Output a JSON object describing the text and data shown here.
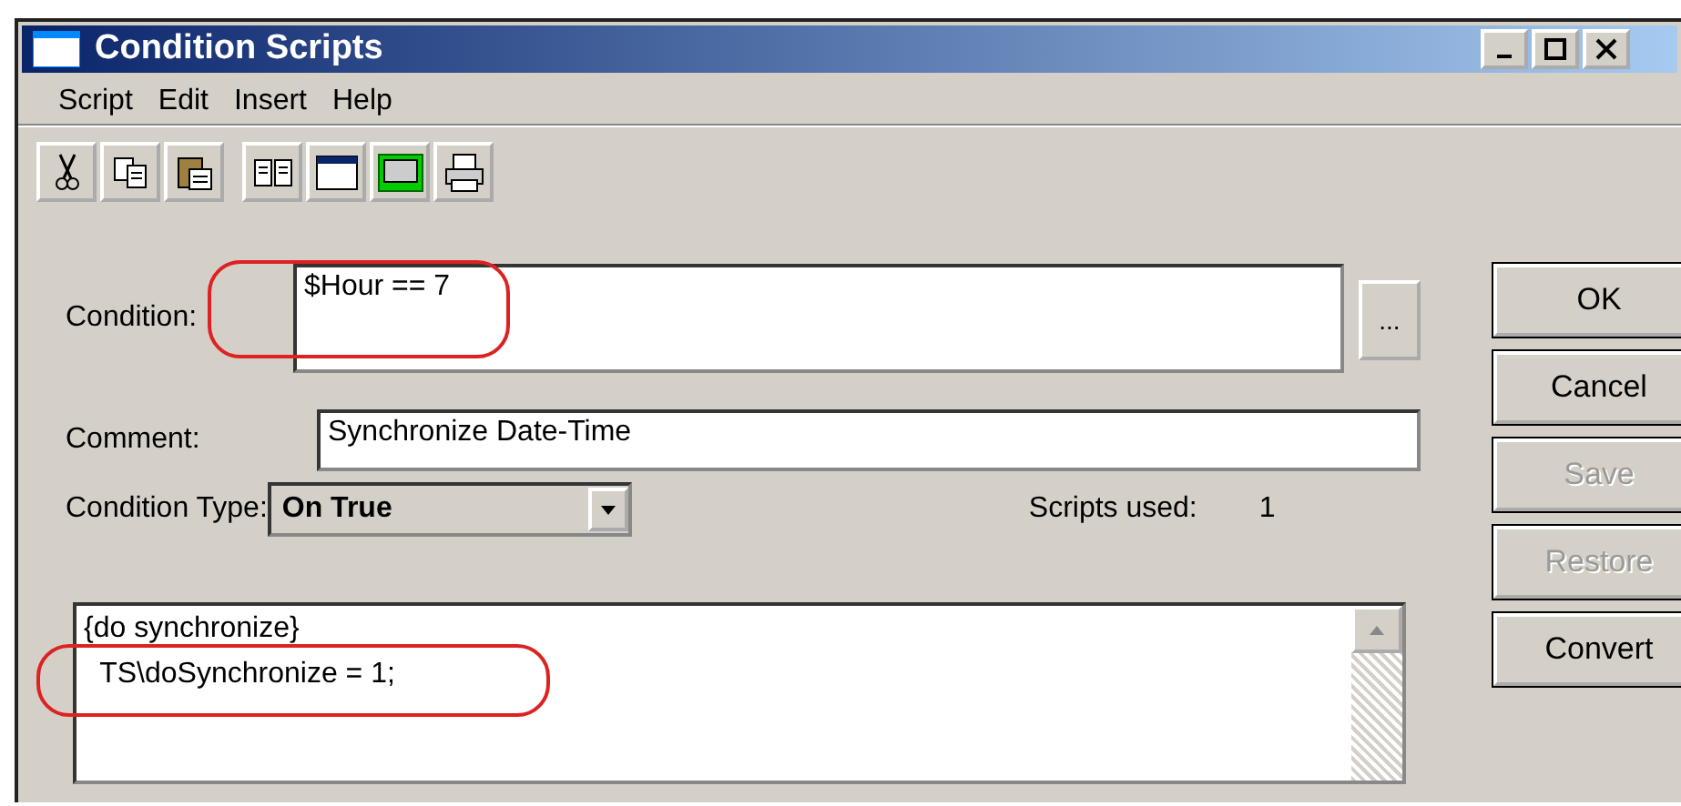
{
  "window": {
    "title": "Condition Scripts"
  },
  "menu": [
    "Script",
    "Edit",
    "Insert",
    "Help"
  ],
  "toolbar": [
    {
      "kind": "cut"
    },
    {
      "kind": "copy"
    },
    {
      "kind": "paste"
    },
    {
      "kind": "sep"
    },
    {
      "kind": "book"
    },
    {
      "kind": "window"
    },
    {
      "kind": "ocx"
    },
    {
      "kind": "print"
    }
  ],
  "condition": {
    "label": "Condition:",
    "value": "$Hour == 7",
    "browse": "..."
  },
  "comment": {
    "label": "Comment:",
    "value": "Synchronize Date-Time"
  },
  "condition_type": {
    "label": "Condition Type:",
    "value": "On True"
  },
  "scripts_used": {
    "label": "Scripts used:",
    "value": "1"
  },
  "script_lines": [
    "{do synchronize}",
    "  TS\\doSynchronize = 1;"
  ],
  "buttons": [
    {
      "label": "OK",
      "disabled": false
    },
    {
      "label": "Cancel",
      "disabled": false
    },
    {
      "label": "Save",
      "disabled": true
    },
    {
      "label": "Restore",
      "disabled": true
    },
    {
      "label": "Convert",
      "disabled": false
    }
  ]
}
